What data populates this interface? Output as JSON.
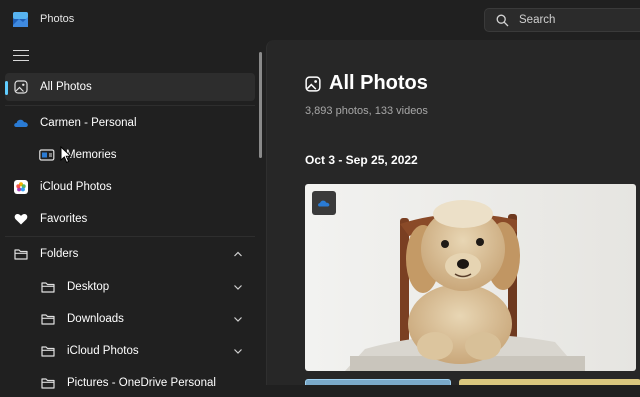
{
  "window": {
    "title": "Photos"
  },
  "search": {
    "placeholder": "Search"
  },
  "sidebar": {
    "items": [
      {
        "label": "All Photos",
        "icon": "photo-icon",
        "active": true
      },
      {
        "label": "Carmen - Personal",
        "icon": "onedrive-cloud-icon"
      },
      {
        "label": "Memories",
        "icon": "memories-icon"
      },
      {
        "label": "iCloud Photos",
        "icon": "icloud-photos-icon"
      },
      {
        "label": "Favorites",
        "icon": "heart-icon"
      },
      {
        "label": "Folders",
        "icon": "folder-icon",
        "expanded": true
      },
      {
        "label": "Desktop",
        "icon": "folder-icon"
      },
      {
        "label": "Downloads",
        "icon": "folder-icon"
      },
      {
        "label": "iCloud Photos",
        "icon": "folder-icon"
      },
      {
        "label": "Pictures - OneDrive Personal",
        "icon": "folder-icon"
      }
    ]
  },
  "main": {
    "title": "All Photos",
    "count": "3,893 photos, 133 videos",
    "date_range": "Oct 3 - Sep 25, 2022"
  },
  "colors": {
    "accent": "#60cdff",
    "background": "#202020",
    "content": "#272727",
    "onedrive": "#2a7bd4"
  }
}
